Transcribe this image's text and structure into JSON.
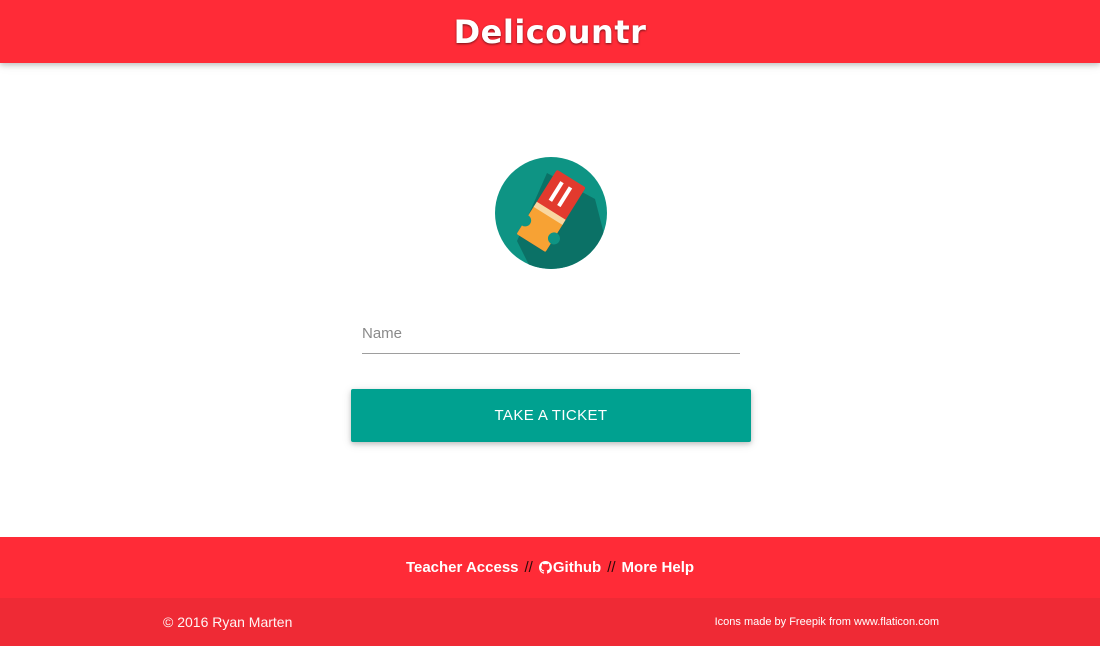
{
  "header": {
    "title": "Delicountr"
  },
  "main": {
    "logo_icon": "ticket-icon",
    "name_input": {
      "placeholder": "Name",
      "value": ""
    },
    "submit_label": "TAKE A TICKET"
  },
  "footer": {
    "links": {
      "teacher_access": "Teacher Access",
      "separator": "//",
      "github": "Github",
      "more_help": "More Help"
    },
    "copyright": "© 2016 Ryan Marten",
    "credits": {
      "prefix": "Icons made by",
      "author": "Freepik",
      "middle": "from",
      "site": "www.flaticon.com"
    }
  },
  "colors": {
    "brand_red": "#ff2b37",
    "footer_dark_red": "#ef2a35",
    "accent_teal": "#00a190"
  }
}
